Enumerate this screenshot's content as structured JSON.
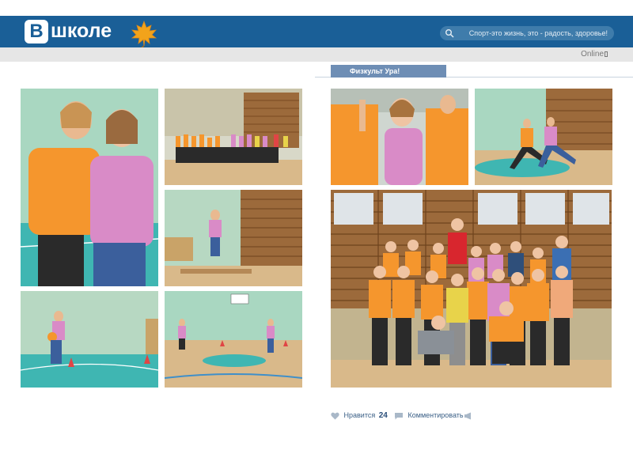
{
  "header": {
    "logo_letter": "В",
    "logo_text": "школе",
    "search_text": "Спорт-это жизнь, это - радость, здоровье!"
  },
  "status": {
    "online": "Online"
  },
  "album": {
    "title": "Физкульт Ура!"
  },
  "actions": {
    "like_label": "Нравится",
    "like_count": "24",
    "comment_label": "Комментировать"
  },
  "colors": {
    "header_bg": "#1a5f97",
    "tab_bg": "#6e8eb5",
    "shirt_orange": "#f5962d",
    "shirt_pink": "#d98bc7",
    "floor": "#d9b98a",
    "court_teal": "#3fb6b2",
    "wall_green": "#a7d5b5"
  }
}
